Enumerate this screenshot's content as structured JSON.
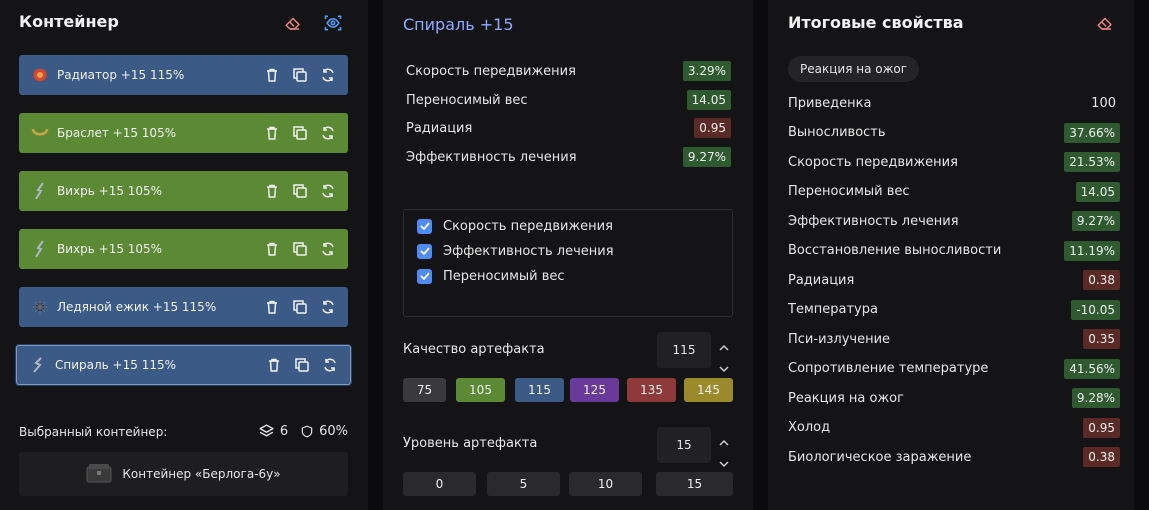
{
  "left": {
    "title": "Контейнер",
    "items": [
      {
        "label": "Радиатор +15 115%",
        "color": "blue",
        "icon": "radiator-artifact-icon"
      },
      {
        "label": "Браслет +15 105%",
        "color": "green",
        "icon": "bracelet-artifact-icon"
      },
      {
        "label": "Вихрь +15 105%",
        "color": "green",
        "icon": "whirl-artifact-icon"
      },
      {
        "label": "Вихрь +15 105%",
        "color": "green",
        "icon": "whirl-artifact-icon"
      },
      {
        "label": "Ледяной ежик +15 115%",
        "color": "blue",
        "icon": "ice-hedgehog-artifact-icon"
      },
      {
        "label": "Спираль +15 115%",
        "color": "blue",
        "icon": "spiral-artifact-icon"
      }
    ],
    "selected_label": "Выбранный контейнер:",
    "slots": "6",
    "protection": "60%",
    "container_name": "Контейнер «Берлога-6у»"
  },
  "middle": {
    "title": "Спираль +15",
    "props": [
      {
        "label": "Скорость передвижения",
        "value": "3.29%",
        "tone": "g"
      },
      {
        "label": "Переносимый вес",
        "value": "14.05",
        "tone": "g"
      },
      {
        "label": "Радиация",
        "value": "0.95",
        "tone": "r"
      },
      {
        "label": "Эффективность лечения",
        "value": "9.27%",
        "tone": "g"
      }
    ],
    "checks": [
      "Скорость передвижения",
      "Эффективность лечения",
      "Переносимый вес"
    ],
    "quality_label": "Качество артефакта",
    "quality_value": "115",
    "quality_options": [
      "75",
      "105",
      "115",
      "125",
      "135",
      "145"
    ],
    "level_label": "Уровень артефакта",
    "level_value": "15",
    "level_options": [
      "0",
      "5",
      "10",
      "15"
    ]
  },
  "right": {
    "title": "Итоговые свойства",
    "tag": "Реакция на ожог",
    "props": [
      {
        "label": "Приведенка",
        "value": "100",
        "tone": "none"
      },
      {
        "label": "Выносливость",
        "value": "37.66%",
        "tone": "g"
      },
      {
        "label": "Скорость передвижения",
        "value": "21.53%",
        "tone": "g"
      },
      {
        "label": "Переносимый вес",
        "value": "14.05",
        "tone": "g"
      },
      {
        "label": "Эффективность лечения",
        "value": "9.27%",
        "tone": "g"
      },
      {
        "label": "Восстановление выносливости",
        "value": "11.19%",
        "tone": "g"
      },
      {
        "label": "Радиация",
        "value": "0.38",
        "tone": "r"
      },
      {
        "label": "Температура",
        "value": "-10.05",
        "tone": "g"
      },
      {
        "label": "Пси-излучение",
        "value": "0.35",
        "tone": "r"
      },
      {
        "label": "Сопротивление температуре",
        "value": "41.56%",
        "tone": "g"
      },
      {
        "label": "Реакция на ожог",
        "value": "9.28%",
        "tone": "g"
      },
      {
        "label": "Холод",
        "value": "0.95",
        "tone": "r"
      },
      {
        "label": "Биологическое заражение",
        "value": "0.38",
        "tone": "r"
      }
    ]
  },
  "colors": {
    "item_blue": "#3b5a86",
    "item_green": "#5c8a34",
    "positive": "#2f5a30",
    "negative": "#5b2a27",
    "accent": "#8ea8ff",
    "checkbox": "#4e8cf5"
  }
}
